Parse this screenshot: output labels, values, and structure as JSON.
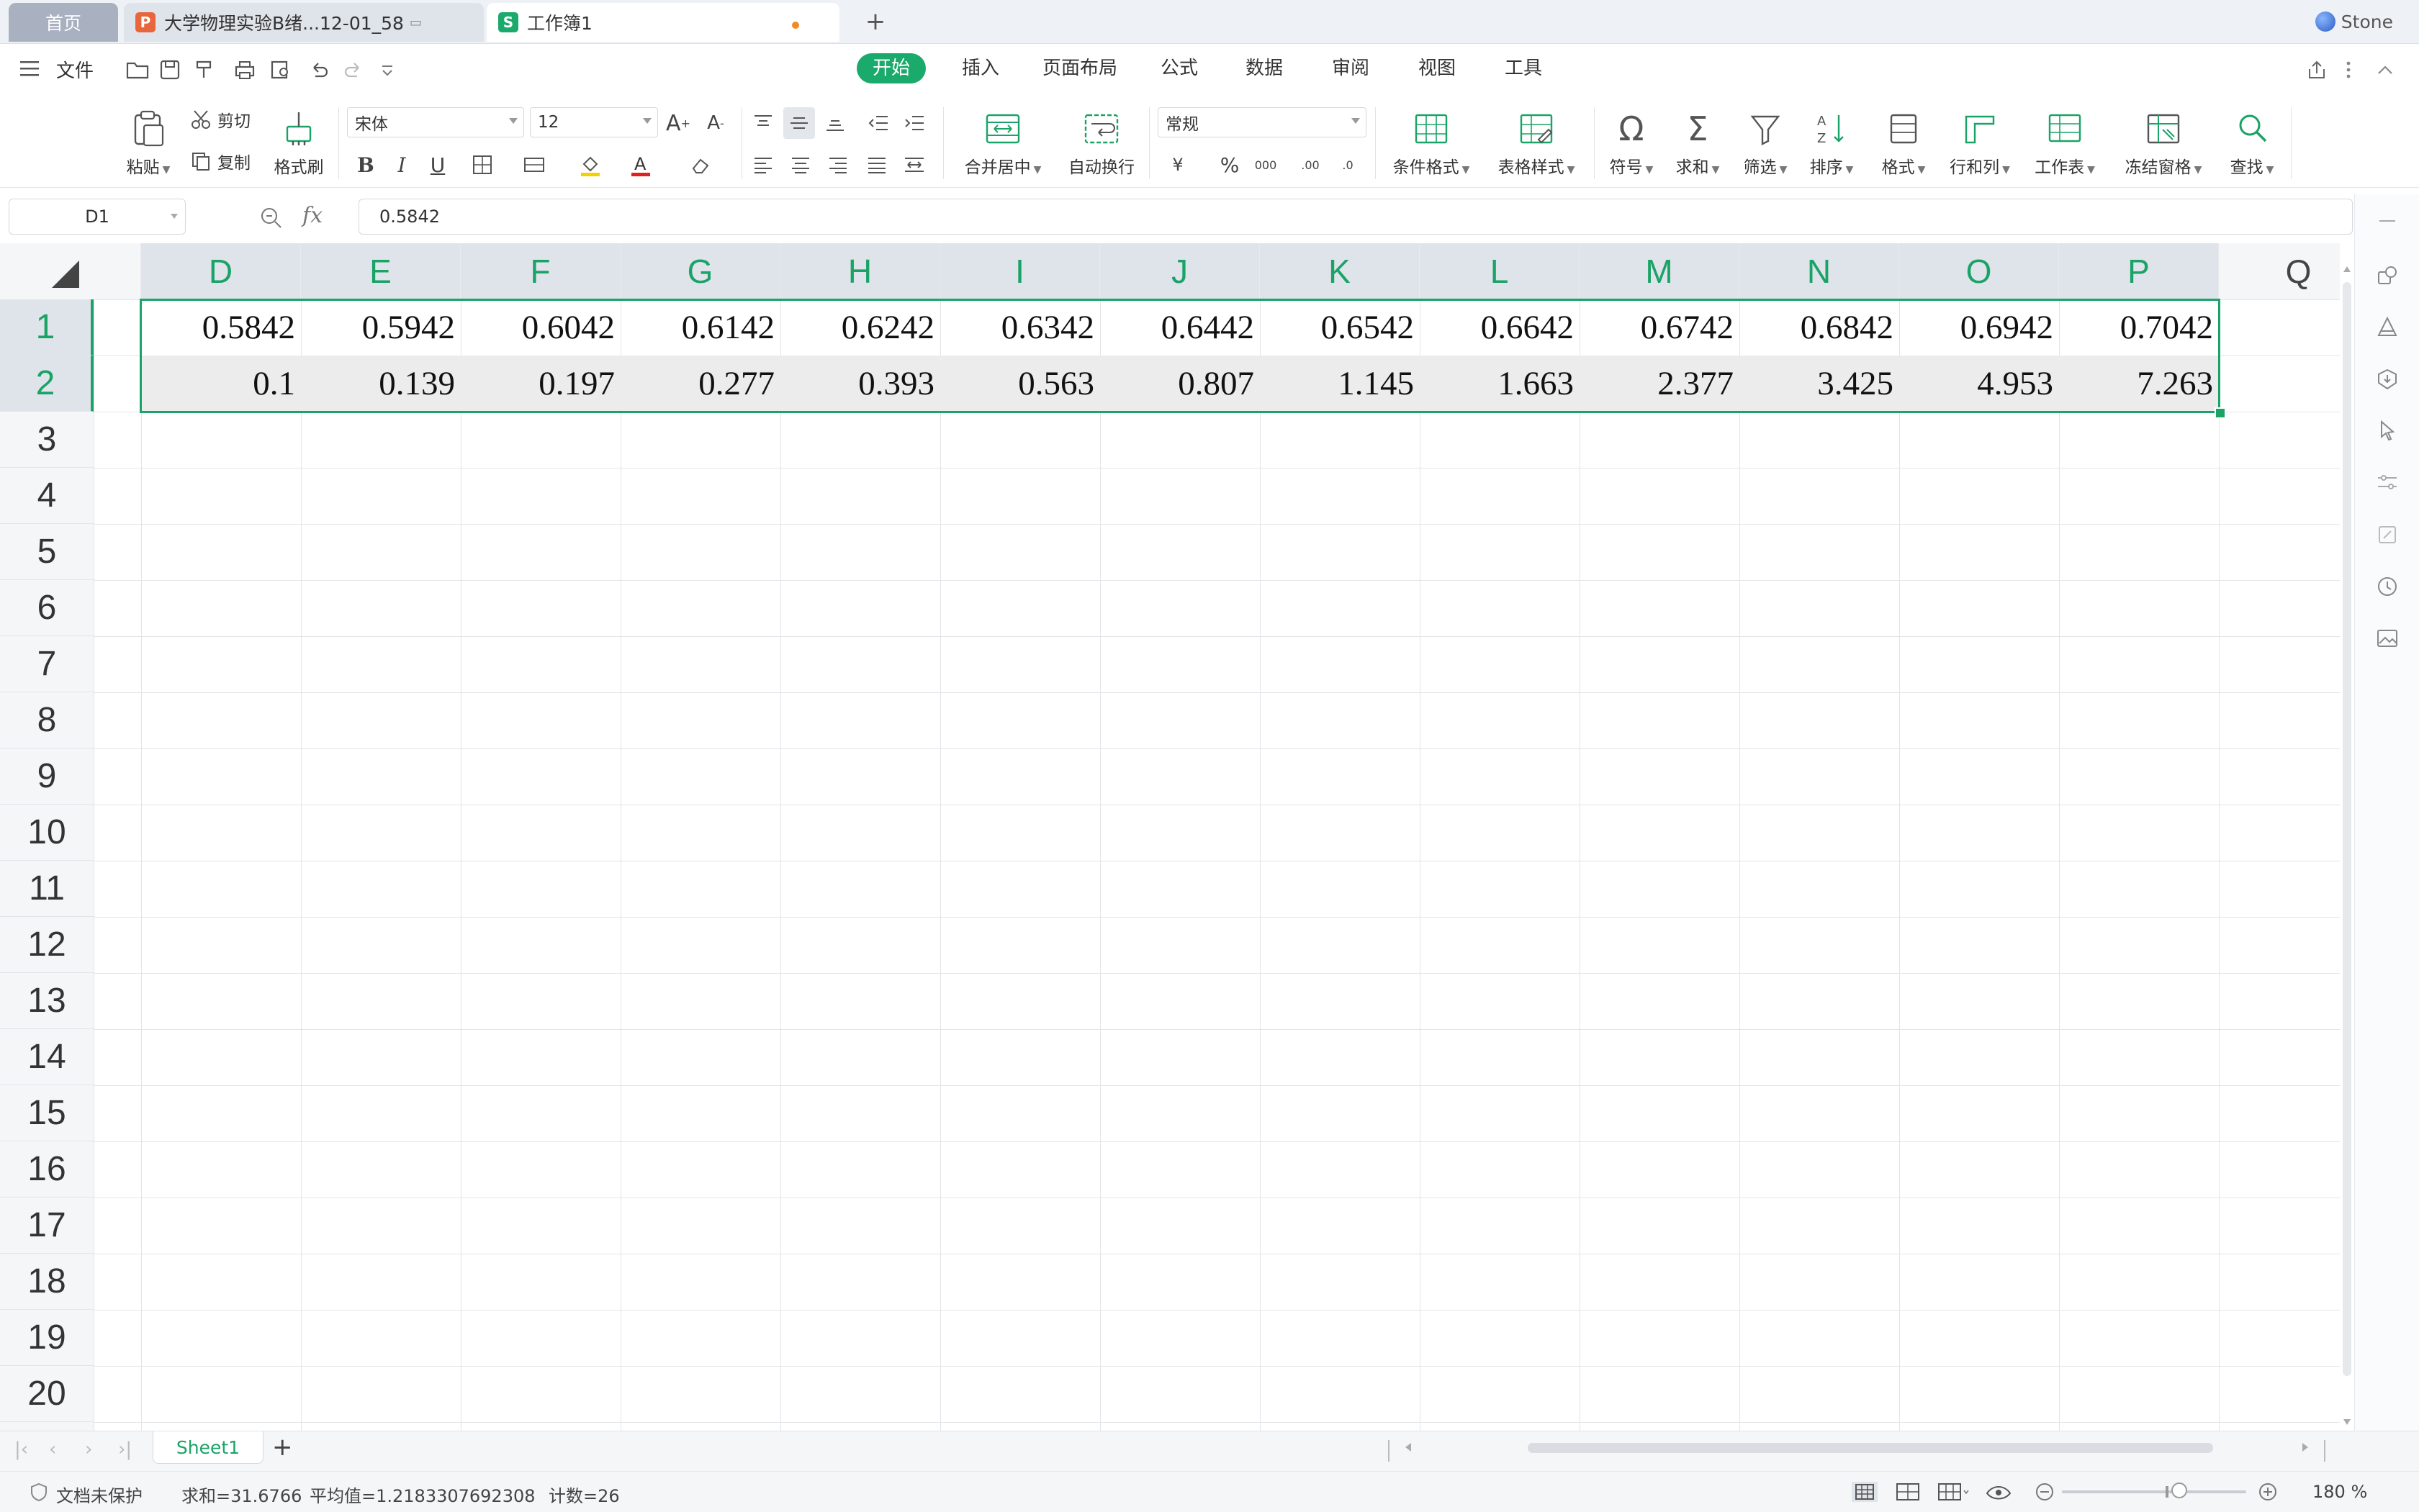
{
  "tabs": {
    "home": "首页",
    "doc": "大学物理实验B绪...12-01_58",
    "book": "工作簿1",
    "user": "Stone"
  },
  "menu": {
    "file": "文件",
    "ribbon_tabs": [
      "开始",
      "插入",
      "页面布局",
      "公式",
      "数据",
      "审阅",
      "视图",
      "工具"
    ],
    "active_tab": "开始"
  },
  "ribbon": {
    "paste": "粘贴",
    "cut": "剪切",
    "copy": "复制",
    "format_painter": "格式刷",
    "font_name": "宋体",
    "font_size": "12",
    "merge_center": "合并居中",
    "wrap_text": "自动换行",
    "number_format": "常规",
    "conditional_format": "条件格式",
    "table_style": "表格样式",
    "symbol": "符号",
    "sum": "求和",
    "filter": "筛选",
    "sort": "排序",
    "format": "格式",
    "rows_cols": "行和列",
    "worksheet": "工作表",
    "freeze": "冻结窗格",
    "find": "查找"
  },
  "formula_bar": {
    "name_box": "D1",
    "fx": "fx",
    "value": "0.5842"
  },
  "sheet": {
    "columns": [
      "D",
      "E",
      "F",
      "G",
      "H",
      "I",
      "J",
      "K",
      "L",
      "M",
      "N",
      "O",
      "P",
      "Q"
    ],
    "rows": [
      "1",
      "2",
      "3",
      "4",
      "5",
      "6",
      "7",
      "8",
      "9",
      "10",
      "11",
      "12",
      "13",
      "14",
      "15",
      "16",
      "17",
      "18",
      "19",
      "20"
    ],
    "row1": [
      "0.5842",
      "0.5942",
      "0.6042",
      "0.6142",
      "0.6242",
      "0.6342",
      "0.6442",
      "0.6542",
      "0.6642",
      "0.6742",
      "0.6842",
      "0.6942",
      "0.7042"
    ],
    "row2": [
      "0.1",
      "0.139",
      "0.197",
      "0.277",
      "0.393",
      "0.563",
      "0.807",
      "1.145",
      "1.663",
      "2.377",
      "3.425",
      "4.953",
      "7.263"
    ],
    "active_tab": "Sheet1",
    "add_sheet": "+"
  },
  "status": {
    "protect": "文档未保护",
    "sum": "求和=31.6766",
    "average": "平均值=1.2183307692308",
    "count": "计数=26",
    "zoom": "180 %"
  },
  "colors": {
    "accent": "#1aa367",
    "tab_active": "#1aaa6b"
  }
}
